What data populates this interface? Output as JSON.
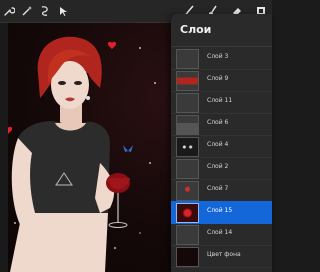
{
  "layers_panel": {
    "title": "Слои",
    "layers": [
      {
        "name": "Слой 3"
      },
      {
        "name": "Слой 9"
      },
      {
        "name": "Слой 11"
      },
      {
        "name": "Слой 6"
      },
      {
        "name": "Слой 4"
      },
      {
        "name": "Слой 2"
      },
      {
        "name": "Слой 7"
      },
      {
        "name": "Слой 15",
        "active": true
      },
      {
        "name": "Слой 14"
      },
      {
        "name": "Цвет фона"
      }
    ]
  },
  "toolbar": {
    "left_icons": [
      "wrench-icon",
      "magic-wand-icon",
      "selection-icon",
      "transform-arrow-icon"
    ],
    "right_icons": [
      "brush-icon",
      "smudge-icon",
      "eraser-icon",
      "layers-icon"
    ]
  },
  "colors": {
    "active_layer": "#1467d8",
    "panel_bg": "#2a2a2a",
    "canvas_bg": "#140808"
  }
}
